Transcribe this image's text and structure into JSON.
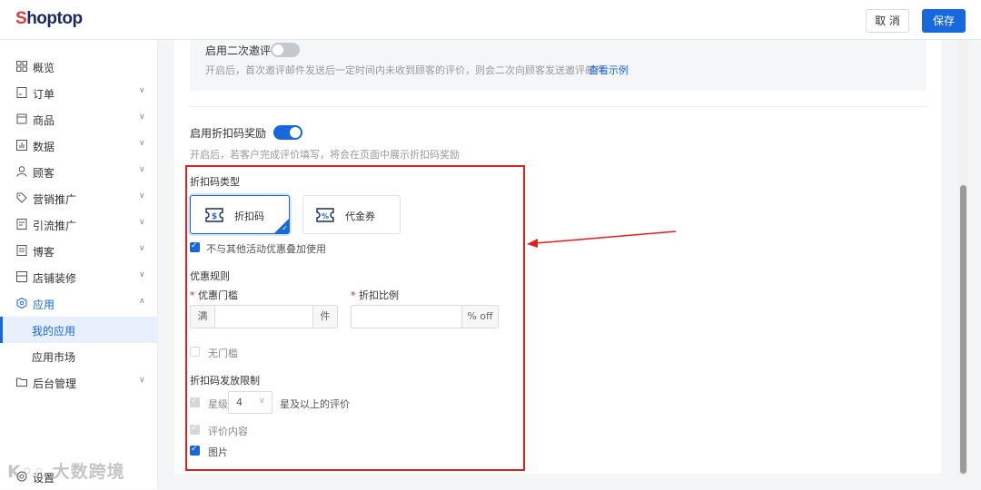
{
  "header": {
    "logo_first": "S",
    "logo_rest": "hoptop",
    "cancel_label": "取 消",
    "save_label": "保存"
  },
  "sidebar": {
    "items": [
      {
        "label": "概览",
        "icon": "overview-icon"
      },
      {
        "label": "订单",
        "icon": "order-icon"
      },
      {
        "label": "商品",
        "icon": "product-icon"
      },
      {
        "label": "数据",
        "icon": "chart-icon"
      },
      {
        "label": "顾客",
        "icon": "user-icon"
      },
      {
        "label": "营销推广",
        "icon": "tag-icon"
      },
      {
        "label": "引流推广",
        "icon": "traffic-icon"
      },
      {
        "label": "博客",
        "icon": "blog-icon"
      },
      {
        "label": "店铺装修",
        "icon": "store-icon"
      },
      {
        "label": "应用",
        "icon": "app-icon"
      },
      {
        "label": "我的应用"
      },
      {
        "label": "应用市场"
      },
      {
        "label": "后台管理",
        "icon": "folder-icon"
      },
      {
        "label": "设置",
        "icon": "settings-icon"
      }
    ]
  },
  "secondary_review": {
    "label": "启用二次邀评",
    "enabled": false,
    "hint": "开启后，首次邀评邮件发送后一定时间内未收到顾客的评价，则会二次向顾客发送邀评邮件",
    "link": "查看示例"
  },
  "discount_reward": {
    "label": "启用折扣码奖励",
    "enabled": true,
    "hint": "开启后，若客户完成评价填写，将会在页面中展示折扣码奖励"
  },
  "code_type": {
    "title": "折扣码类型",
    "options": [
      {
        "label": "折扣码",
        "icon_text": "$",
        "selected": true
      },
      {
        "label": "代金券",
        "icon_text": "%",
        "selected": false
      }
    ],
    "no_stack_label": "不与其他活动优惠叠加使用",
    "no_stack_checked": true
  },
  "rules": {
    "title": "优惠规则",
    "threshold_label": "优惠门槛",
    "threshold_prefix": "满",
    "threshold_suffix": "件",
    "threshold_value": "",
    "ratio_label": "折扣比例",
    "ratio_suffix": "% off",
    "ratio_value": "",
    "no_threshold_label": "无门槛",
    "no_threshold_checked": false,
    "required_mark": "*"
  },
  "limits": {
    "title": "折扣码发放限制",
    "star_label": "星级",
    "star_value": "4",
    "star_suffix": "星及以上的评价",
    "content_label": "评价内容",
    "image_label": "图片",
    "image_checked": true
  },
  "watermark": "K◦◦ 大数跨境",
  "colors": {
    "primary": "#1668dc",
    "annotation_red": "#e02020"
  }
}
